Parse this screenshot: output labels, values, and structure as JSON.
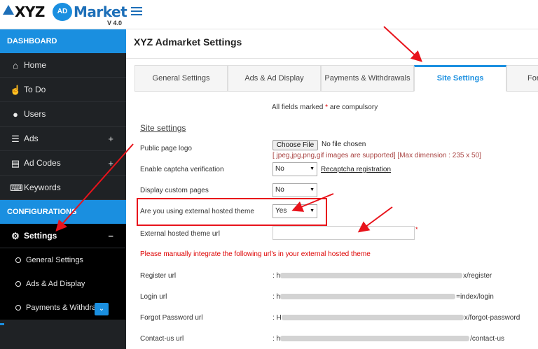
{
  "app": {
    "logo_xyz": "XYZ",
    "logo_ad": "AD",
    "logo_market": "Market",
    "version": "V 4.0"
  },
  "sidebar": {
    "dashboard_label": "DASHBOARD",
    "items": [
      {
        "label": "Home",
        "icon": "home-icon"
      },
      {
        "label": "To Do",
        "icon": "thumbs-up-icon"
      },
      {
        "label": "Users",
        "icon": "users-icon"
      },
      {
        "label": "Ads",
        "icon": "list-icon",
        "expand": "+"
      },
      {
        "label": "Ad Codes",
        "icon": "code-document-icon",
        "expand": "+"
      },
      {
        "label": "Keywords",
        "icon": "keyboard-icon"
      }
    ],
    "configurations_label": "CONFIGURATIONS",
    "settings": {
      "label": "Settings",
      "icon": "gear-icon",
      "collapse": "−"
    },
    "sub_items": [
      {
        "label": "General Settings"
      },
      {
        "label": "Ads & Ad Display"
      },
      {
        "label": "Payments & Withdrav"
      }
    ]
  },
  "main": {
    "page_title": "XYZ Admarket Settings",
    "tabs": [
      {
        "label": "General Settings",
        "active": false
      },
      {
        "label": "Ads & Ad Display",
        "active": false
      },
      {
        "label": "Payments & Withdrawals",
        "active": false
      },
      {
        "label": "Site Settings",
        "active": true
      },
      {
        "label": "For",
        "active": false
      }
    ],
    "compulsory_prefix": "All fields marked",
    "compulsory_star": "*",
    "compulsory_suffix": "are compulsory",
    "section_heading": "Site settings",
    "fields": {
      "logo_label": "Public page logo",
      "file_button": "Choose File",
      "file_status": "No file chosen",
      "file_note": "[ jpeg,jpg,png,gif images are supported] [Max dimension : 235 x 50]",
      "captcha_label": "Enable captcha verification",
      "captcha_value": "No",
      "recaptcha_link": "Recaptcha registration",
      "custom_pages_label": "Display custom pages",
      "custom_pages_value": "No",
      "external_theme_label": "Are you using external hosted theme",
      "external_theme_value": "Yes",
      "theme_url_label": "External hosted theme url",
      "theme_url_value": "",
      "required_star": "*"
    },
    "notice": "Please manually integrate the following url's in your external hosted theme",
    "urls": [
      {
        "label": "Register url",
        "prefix": ": h",
        "suffix": "x/register"
      },
      {
        "label": "Login url",
        "prefix": ": h",
        "suffix": "=index/login"
      },
      {
        "label": "Forgot Password url",
        "prefix": ": H",
        "suffix": "x/forgot-password"
      },
      {
        "label": "Contact-us url",
        "prefix": ": h",
        "suffix": "/contact-us"
      }
    ]
  },
  "colors": {
    "accent": "#1a8fe0",
    "sidebar_bg": "#1f2225",
    "annotation_red": "#e8131b",
    "error_red": "#dd0000"
  }
}
